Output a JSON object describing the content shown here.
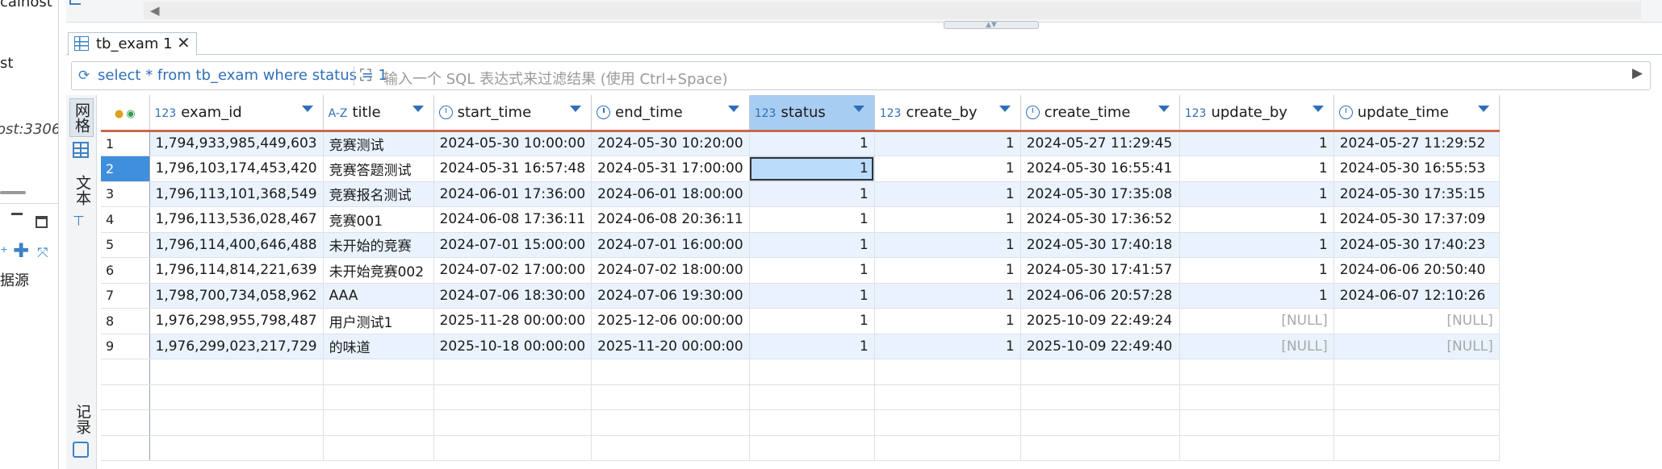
{
  "left_panel": {
    "items": [
      "calhost",
      "st",
      "ost:3306",
      "据源"
    ]
  },
  "tab": {
    "label": "tb_exam 1"
  },
  "filter": {
    "query": "select * from tb_exam where status = 1",
    "placeholder": "输入一个 SQL 表达式来过滤结果 (使用 Ctrl+Space)"
  },
  "side_tabs": {
    "grid": "网格",
    "text": "文本",
    "record": "记录"
  },
  "columns": [
    {
      "type": "123",
      "name": "exam_id"
    },
    {
      "type": "A-Z",
      "name": "title"
    },
    {
      "type": "clock",
      "name": "start_time"
    },
    {
      "type": "clock",
      "name": "end_time"
    },
    {
      "type": "123",
      "name": "status"
    },
    {
      "type": "123",
      "name": "create_by"
    },
    {
      "type": "clock",
      "name": "create_time"
    },
    {
      "type": "123",
      "name": "update_by"
    },
    {
      "type": "clock",
      "name": "update_time"
    }
  ],
  "rows": [
    {
      "n": "1",
      "exam_id": "1,794,933,985,449,603",
      "title": "竞赛测试",
      "start_time": "2024-05-30 10:00:00",
      "end_time": "2024-05-30 10:20:00",
      "status": "1",
      "create_by": "1",
      "create_time": "2024-05-27 11:29:45",
      "update_by": "1",
      "update_time": "2024-05-27 11:29:52"
    },
    {
      "n": "2",
      "exam_id": "1,796,103,174,453,420",
      "title": "竞赛答题测试",
      "start_time": "2024-05-31 16:57:48",
      "end_time": "2024-05-31 17:00:00",
      "status": "1",
      "create_by": "1",
      "create_time": "2024-05-30 16:55:41",
      "update_by": "1",
      "update_time": "2024-05-30 16:55:53"
    },
    {
      "n": "3",
      "exam_id": "1,796,113,101,368,549",
      "title": "竞赛报名测试",
      "start_time": "2024-06-01 17:36:00",
      "end_time": "2024-06-01 18:00:00",
      "status": "1",
      "create_by": "1",
      "create_time": "2024-05-30 17:35:08",
      "update_by": "1",
      "update_time": "2024-05-30 17:35:15"
    },
    {
      "n": "4",
      "exam_id": "1,796,113,536,028,467",
      "title": "竞赛001",
      "start_time": "2024-06-08 17:36:11",
      "end_time": "2024-06-08 20:36:11",
      "status": "1",
      "create_by": "1",
      "create_time": "2024-05-30 17:36:52",
      "update_by": "1",
      "update_time": "2024-05-30 17:37:09"
    },
    {
      "n": "5",
      "exam_id": "1,796,114,400,646,488",
      "title": "未开始的竞赛",
      "start_time": "2024-07-01 15:00:00",
      "end_time": "2024-07-01 16:00:00",
      "status": "1",
      "create_by": "1",
      "create_time": "2024-05-30 17:40:18",
      "update_by": "1",
      "update_time": "2024-05-30 17:40:23"
    },
    {
      "n": "6",
      "exam_id": "1,796,114,814,221,639",
      "title": "未开始竞赛002",
      "start_time": "2024-07-02 17:00:00",
      "end_time": "2024-07-02 18:00:00",
      "status": "1",
      "create_by": "1",
      "create_time": "2024-05-30 17:41:57",
      "update_by": "1",
      "update_time": "2024-06-06 20:50:40"
    },
    {
      "n": "7",
      "exam_id": "1,798,700,734,058,962",
      "title": "AAA",
      "start_time": "2024-07-06 18:30:00",
      "end_time": "2024-07-06 19:30:00",
      "status": "1",
      "create_by": "1",
      "create_time": "2024-06-06 20:57:28",
      "update_by": "1",
      "update_time": "2024-06-07 12:10:26"
    },
    {
      "n": "8",
      "exam_id": "1,976,298,955,798,487",
      "title": "用户测试1",
      "start_time": "2025-11-28 00:00:00",
      "end_time": "2025-12-06 00:00:00",
      "status": "1",
      "create_by": "1",
      "create_time": "2025-10-09 22:49:24",
      "update_by": "[NULL]",
      "update_time": "[NULL]"
    },
    {
      "n": "9",
      "exam_id": "1,976,299,023,217,729",
      "title": "的味道",
      "start_time": "2025-10-18 00:00:00",
      "end_time": "2025-11-20 00:00:00",
      "status": "1",
      "create_by": "1",
      "create_time": "2025-10-09 22:49:40",
      "update_by": "[NULL]",
      "update_time": "[NULL]"
    }
  ],
  "selected_row": "2",
  "colors": {
    "accent": "#3f8fdd",
    "header_underline": "#c9684f",
    "alt_row": "#eaf3fd",
    "selected_header": "#a7cdf3"
  }
}
